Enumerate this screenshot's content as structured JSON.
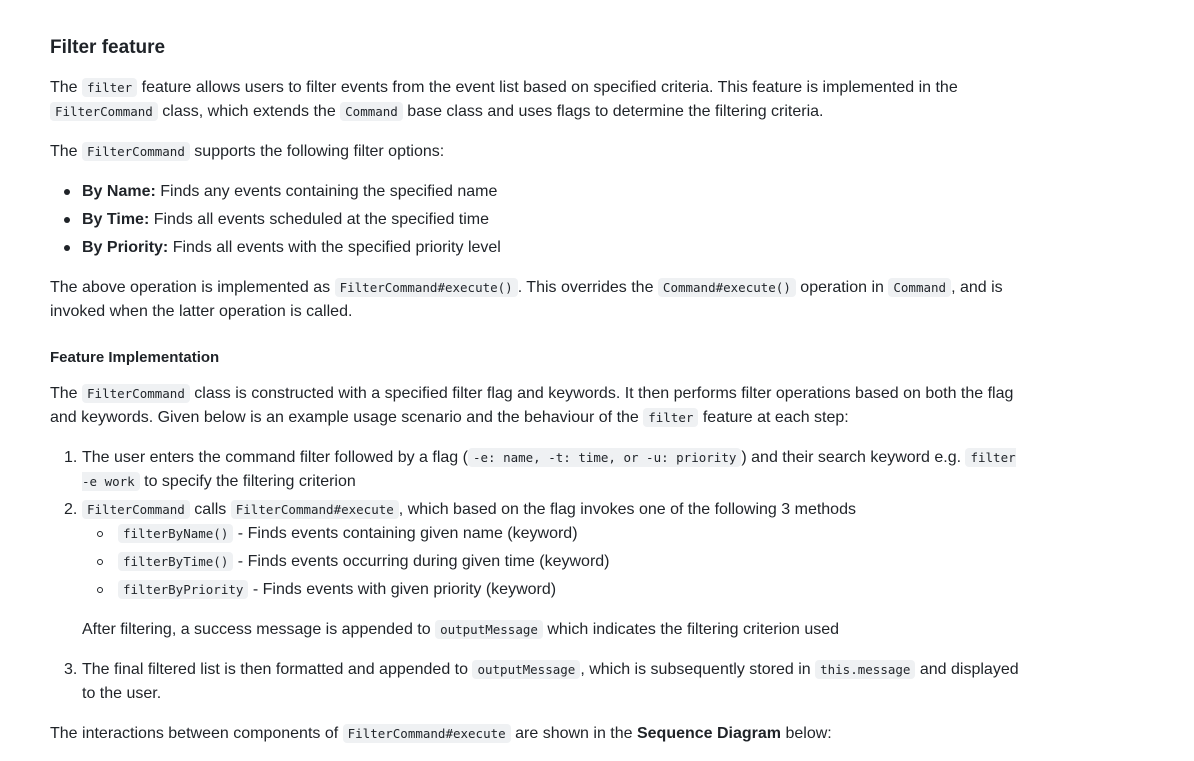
{
  "heading": "Filter feature",
  "p1": {
    "t1": "The ",
    "c1": "filter",
    "t2": " feature allows users to filter events from the event list based on specified criteria. This feature is implemented in the ",
    "c2": "FilterCommand",
    "t3": " class, which extends the ",
    "c3": "Command",
    "t4": " base class and uses flags to determine the filtering criteria."
  },
  "p2": {
    "t1": "The ",
    "c1": "FilterCommand",
    "t2": " supports the following filter options:"
  },
  "options": [
    {
      "label": "By Name:",
      "text": " Finds any events containing the specified name"
    },
    {
      "label": "By Time:",
      "text": " Finds all events scheduled at the specified time"
    },
    {
      "label": "By Priority:",
      "text": " Finds all events with the specified priority level"
    }
  ],
  "p3": {
    "t1": "The above operation is implemented as ",
    "c1": "FilterCommand#execute()",
    "t2": ". This overrides the ",
    "c2": "Command#execute()",
    "t3": " operation in ",
    "c3": "Command",
    "t4": ", and is invoked when the latter operation is called."
  },
  "subheading": "Feature Implementation",
  "p4": {
    "t1": "The ",
    "c1": "FilterCommand",
    "t2": " class is constructed with a specified filter flag and keywords. It then performs filter operations based on both the flag and keywords. Given below is an example usage scenario and the behaviour of the ",
    "c2": "filter",
    "t3": " feature at each step:"
  },
  "steps": {
    "s1": {
      "num": "1.",
      "t1": "The user enters the command filter followed by a flag (",
      "c1": "-e: name, -t: time, or -u: priority",
      "t2": ") and their search keyword e.g. ",
      "c2": "filter -e work",
      "t3": " to specify the filtering criterion"
    },
    "s2": {
      "num": "2.",
      "c1": "FilterCommand",
      "t1": " calls ",
      "c2": "FilterCommand#execute",
      "t2": ", which based on the flag invokes one of the following 3 methods",
      "methods": [
        {
          "code": "filterByName()",
          "text": " - Finds events containing given name (keyword)"
        },
        {
          "code": "filterByTime()",
          "text": " - Finds events occurring during given time (keyword)"
        },
        {
          "code": "filterByPriority",
          "text": " - Finds events with given priority (keyword)"
        }
      ],
      "after_t1": "After filtering, a success message is appended to ",
      "after_c1": "outputMessage",
      "after_t2": " which indicates the filtering criterion used"
    },
    "s3": {
      "num": "3.",
      "t1": "The final filtered list is then formatted and appended to ",
      "c1": "outputMessage",
      "t2": ", which is subsequently stored in ",
      "c2": "this.message",
      "t3": " and displayed to the user."
    }
  },
  "p5": {
    "t1": "The interactions between components of ",
    "c1": "FilterCommand#execute",
    "t2": " are shown in the ",
    "b1": "Sequence Diagram",
    "t3": " below:"
  }
}
